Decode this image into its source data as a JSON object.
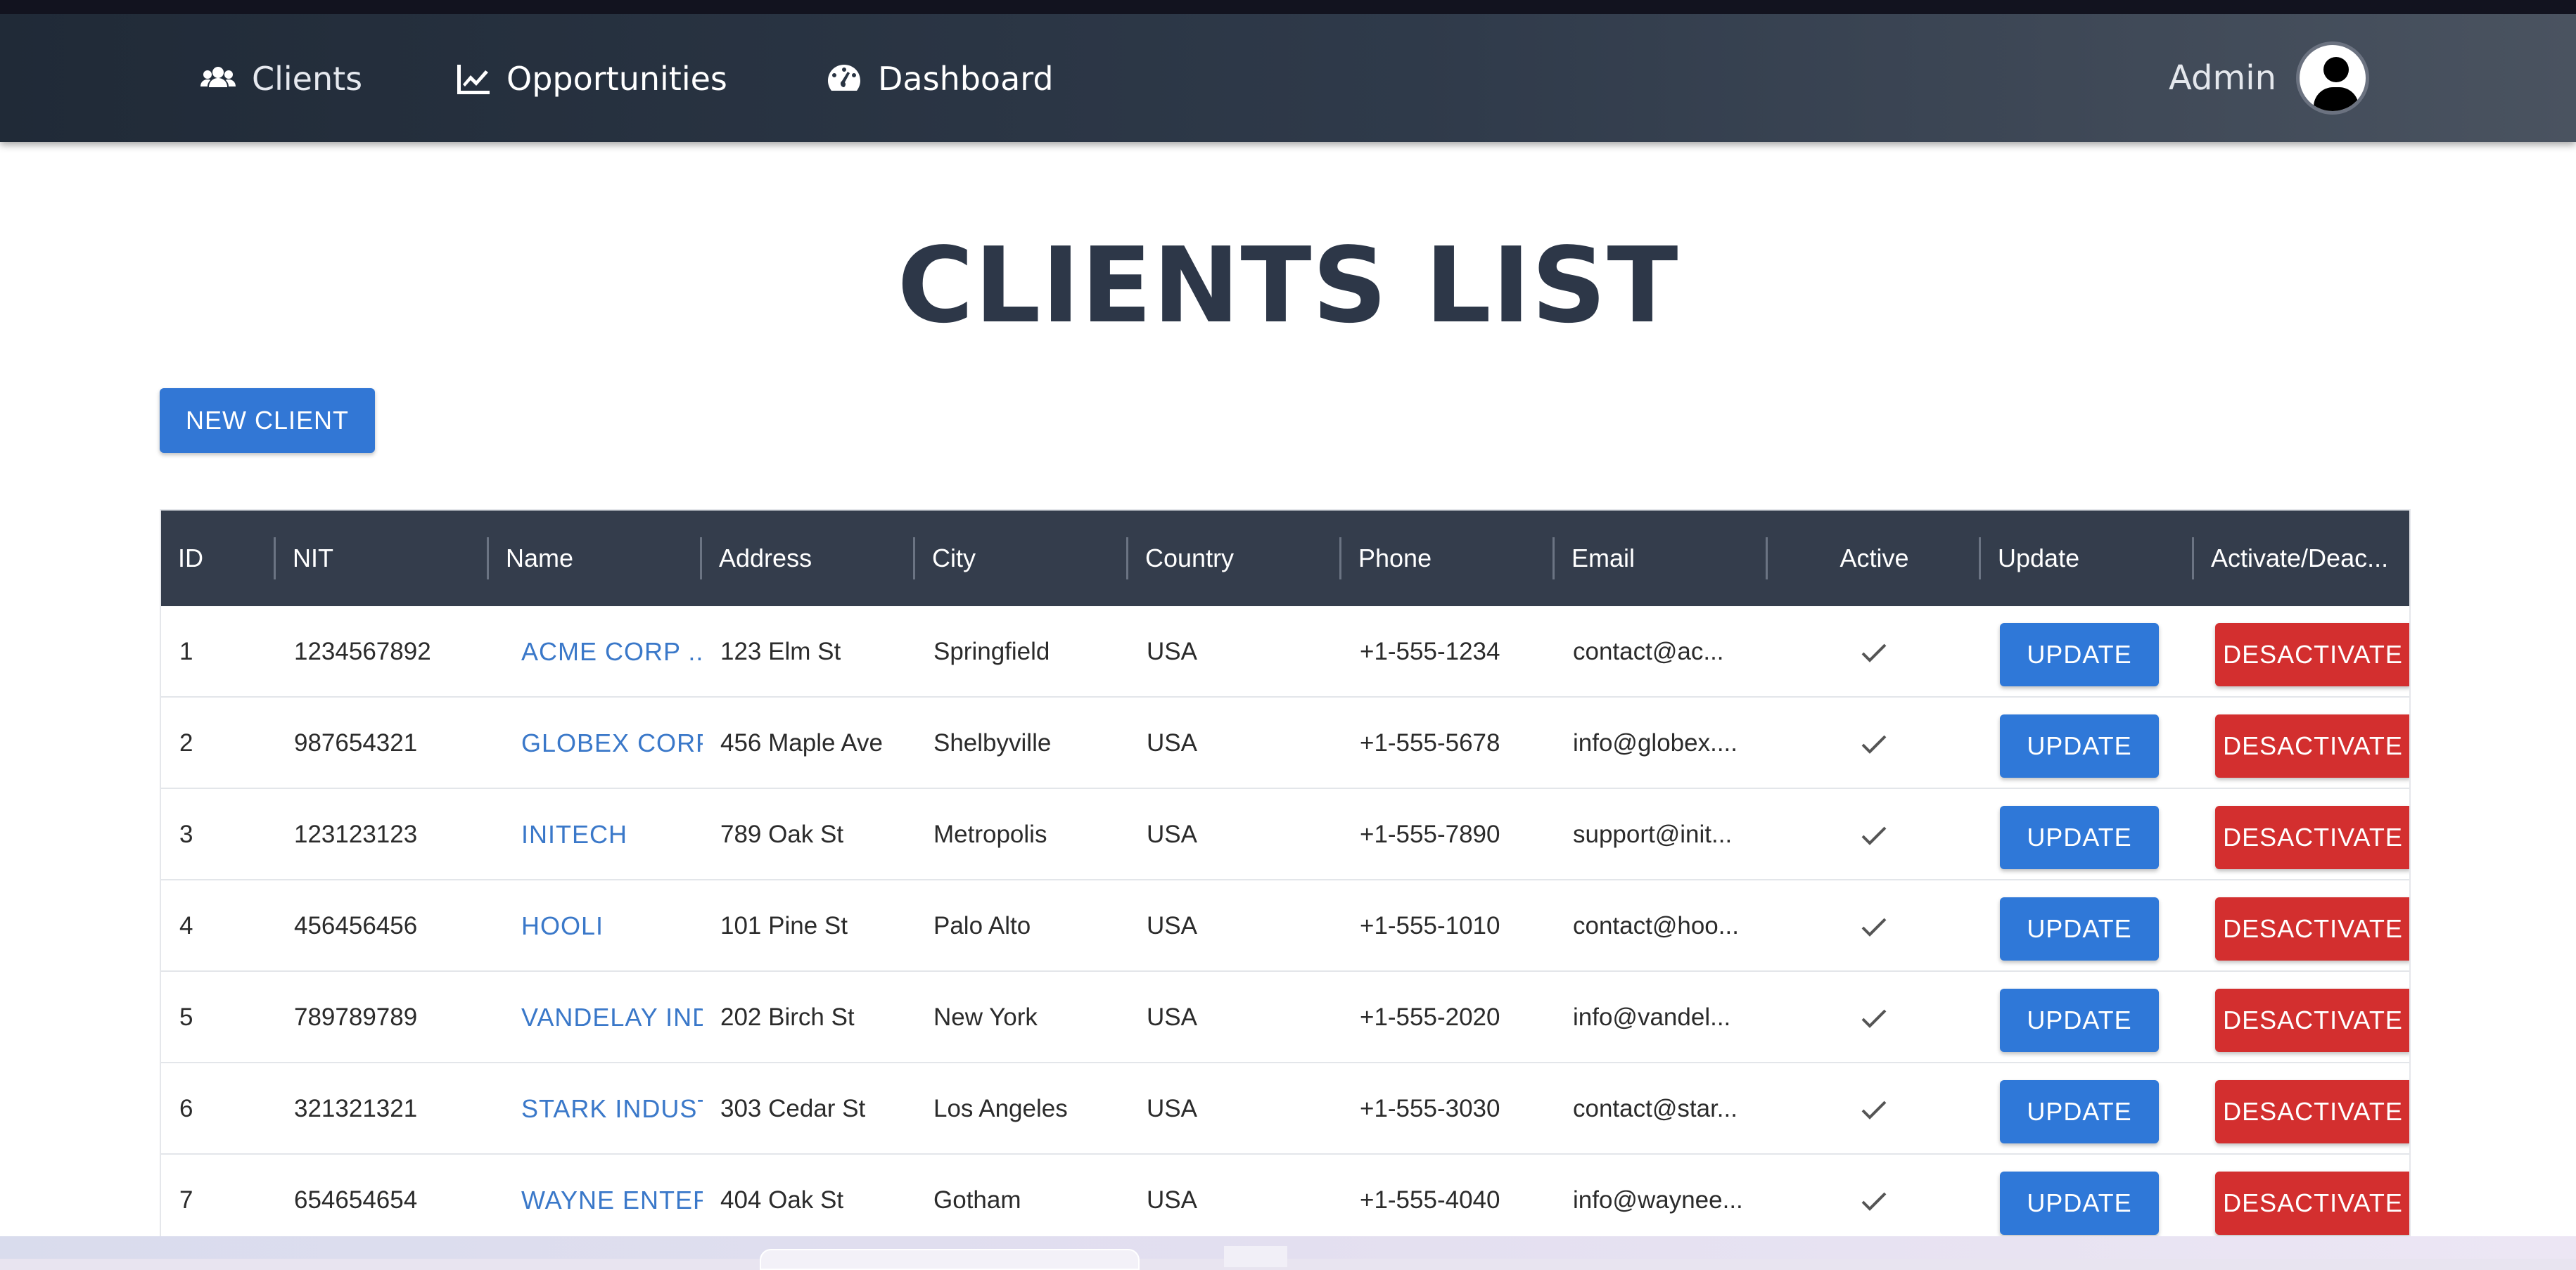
{
  "nav": {
    "clients": "Clients",
    "opportunities": "Opportunities",
    "dashboard": "Dashboard",
    "user": "Admin"
  },
  "page": {
    "title": "CLIENTS LIST",
    "new_client": "NEW CLIENT"
  },
  "table": {
    "headers": {
      "id": "ID",
      "nit": "NIT",
      "name": "Name",
      "address": "Address",
      "city": "City",
      "country": "Country",
      "phone": "Phone",
      "email": "Email",
      "active": "Active",
      "update": "Update",
      "toggle": "Activate/Deac..."
    },
    "update_label": "UPDATE",
    "deactivate_label": "DESACTIVATE",
    "rows": [
      {
        "id": "1",
        "nit": "1234567892",
        "name": "ACME CORP  ..",
        "address": "123 Elm St",
        "city": "Springfield",
        "country": "USA",
        "phone": "+1-555-1234",
        "email": "contact@ac...",
        "active": true
      },
      {
        "id": "2",
        "nit": "987654321",
        "name": "GLOBEX CORP",
        "address": "456 Maple Ave",
        "city": "Shelbyville",
        "country": "USA",
        "phone": "+1-555-5678",
        "email": "info@globex....",
        "active": true
      },
      {
        "id": "3",
        "nit": "123123123",
        "name": "INITECH",
        "address": "789 Oak St",
        "city": "Metropolis",
        "country": "USA",
        "phone": "+1-555-7890",
        "email": "support@init...",
        "active": true
      },
      {
        "id": "4",
        "nit": "456456456",
        "name": "HOOLI",
        "address": "101 Pine St",
        "city": "Palo Alto",
        "country": "USA",
        "phone": "+1-555-1010",
        "email": "contact@hoo...",
        "active": true
      },
      {
        "id": "5",
        "nit": "789789789",
        "name": "VANDELAY IND",
        "address": "202 Birch St",
        "city": "New York",
        "country": "USA",
        "phone": "+1-555-2020",
        "email": "info@vandel...",
        "active": true
      },
      {
        "id": "6",
        "nit": "321321321",
        "name": "STARK INDUST",
        "address": "303 Cedar St",
        "city": "Los Angeles",
        "country": "USA",
        "phone": "+1-555-3030",
        "email": "contact@star...",
        "active": true
      },
      {
        "id": "7",
        "nit": "654654654",
        "name": "WAYNE ENTER",
        "address": "404 Oak St",
        "city": "Gotham",
        "country": "USA",
        "phone": "+1-555-4040",
        "email": "info@waynee...",
        "active": true
      }
    ]
  }
}
